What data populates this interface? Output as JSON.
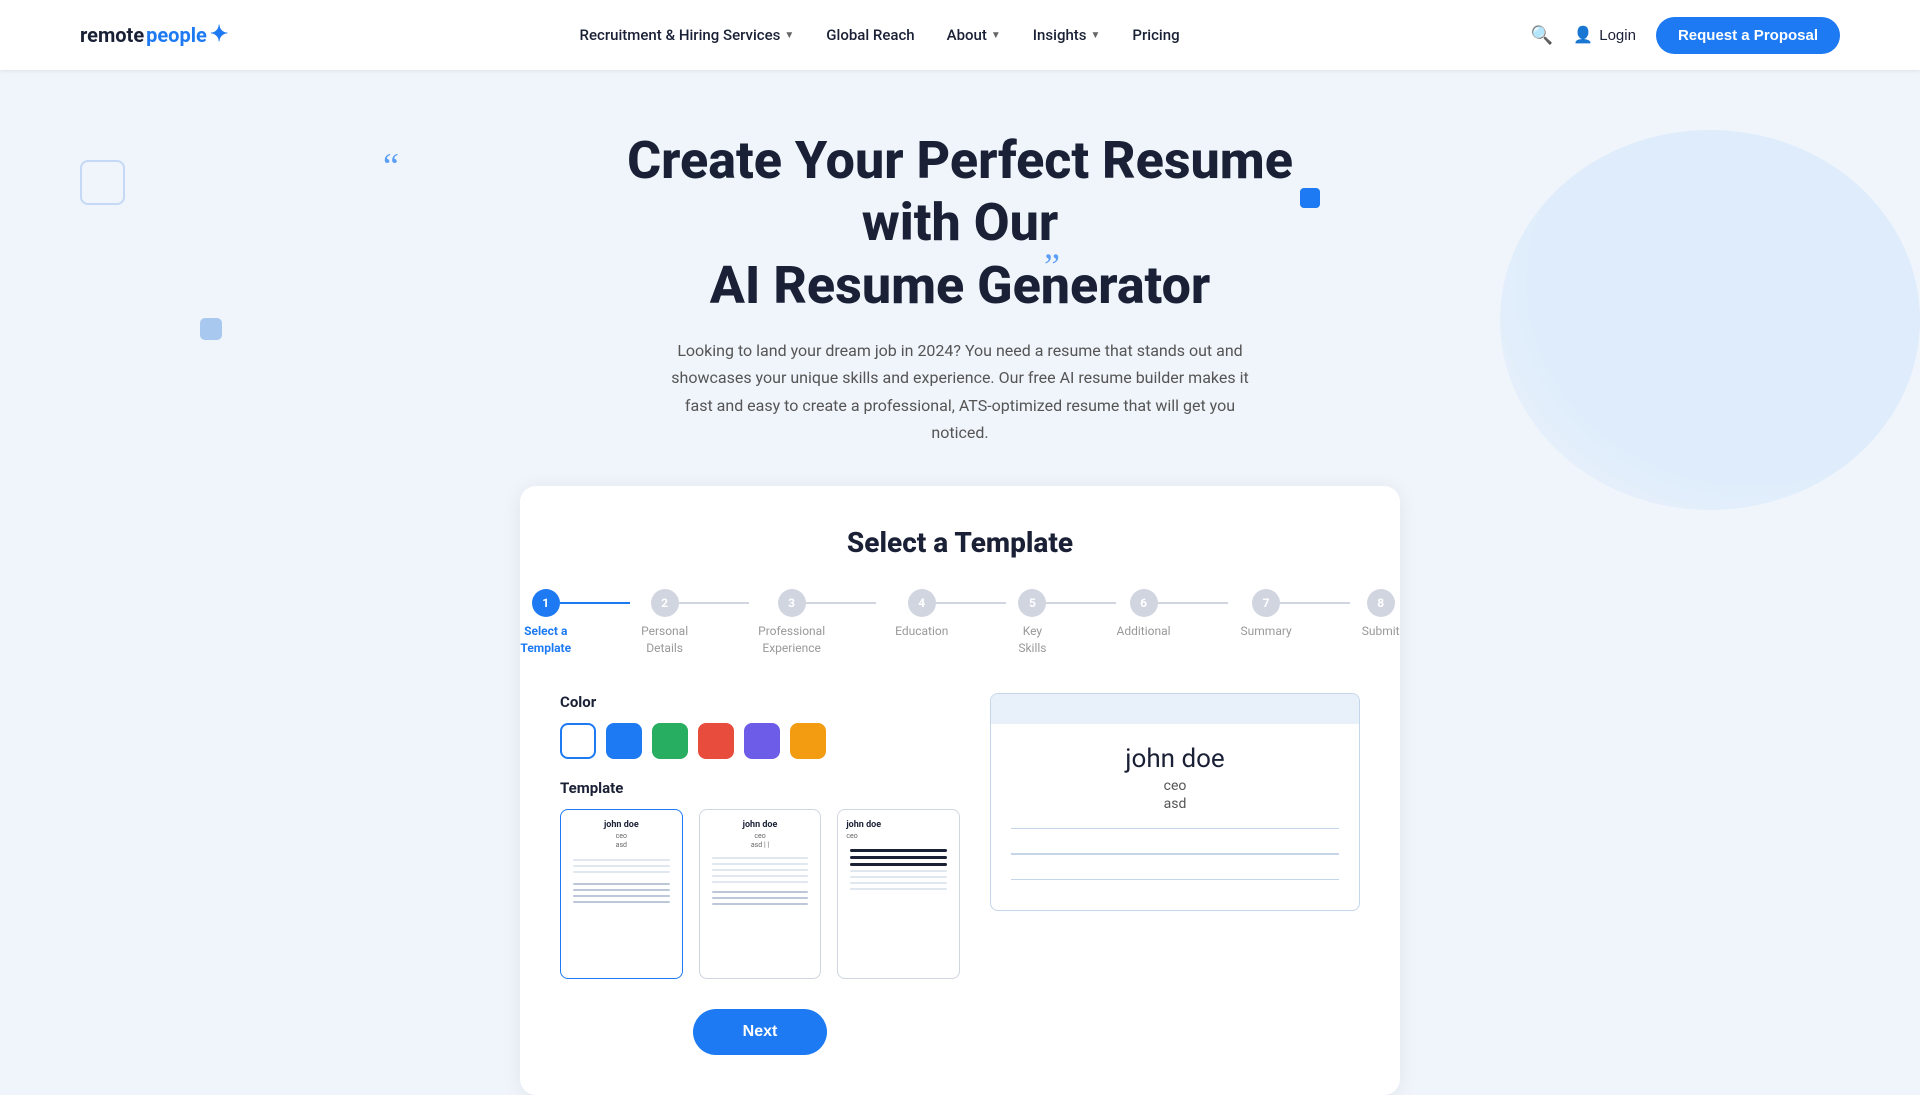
{
  "nav": {
    "logo_text": "remote people",
    "links": [
      {
        "label": "Recruitment & Hiring Services",
        "has_dropdown": true
      },
      {
        "label": "Global Reach",
        "has_dropdown": false
      },
      {
        "label": "About",
        "has_dropdown": true
      },
      {
        "label": "Insights",
        "has_dropdown": true
      },
      {
        "label": "Pricing",
        "has_dropdown": false
      }
    ],
    "login_label": "Login",
    "request_label": "Request a Proposal"
  },
  "hero": {
    "title_line1": "Create Your Perfect Resume with Our",
    "title_line2": "AI Resume Generator",
    "subtitle": "Looking to land your dream job in 2024? You need a resume that stands out and showcases your unique skills and experience. Our free AI resume builder makes it fast and easy to create a professional, ATS-optimized resume that will get you noticed."
  },
  "card": {
    "title": "Select a Template",
    "steps": [
      {
        "number": "1",
        "label": "Select a\nTemplate",
        "active": true
      },
      {
        "number": "2",
        "label": "Personal\nDetails",
        "active": false
      },
      {
        "number": "3",
        "label": "Professional\nExperience",
        "active": false
      },
      {
        "number": "4",
        "label": "Education",
        "active": false
      },
      {
        "number": "5",
        "label": "Key Skills",
        "active": false
      },
      {
        "number": "6",
        "label": "Additional",
        "active": false
      },
      {
        "number": "7",
        "label": "Summary",
        "active": false
      },
      {
        "number": "8",
        "label": "Submit",
        "active": false
      }
    ],
    "color_label": "Color",
    "colors": [
      {
        "name": "white",
        "hex": "#ffffff",
        "selected": true
      },
      {
        "name": "blue",
        "hex": "#1d7af3"
      },
      {
        "name": "green",
        "hex": "#2ecc40"
      },
      {
        "name": "red",
        "hex": "#e74c3c"
      },
      {
        "name": "purple",
        "hex": "#6c5ce7"
      },
      {
        "name": "orange",
        "hex": "#f39c12"
      }
    ],
    "template_label": "Template",
    "templates": [
      {
        "id": 1,
        "name": "john doe",
        "role": "ceo",
        "sub": "asd",
        "selected": true
      },
      {
        "id": 2,
        "name": "john doe",
        "role": "ceo",
        "sub": "asd ||",
        "selected": false
      },
      {
        "id": 3,
        "name": "john doe",
        "role": "ceo",
        "sub": "",
        "selected": false
      }
    ],
    "preview": {
      "name": "john doe",
      "role": "ceo",
      "sub": "asd"
    },
    "next_label": "Next"
  }
}
